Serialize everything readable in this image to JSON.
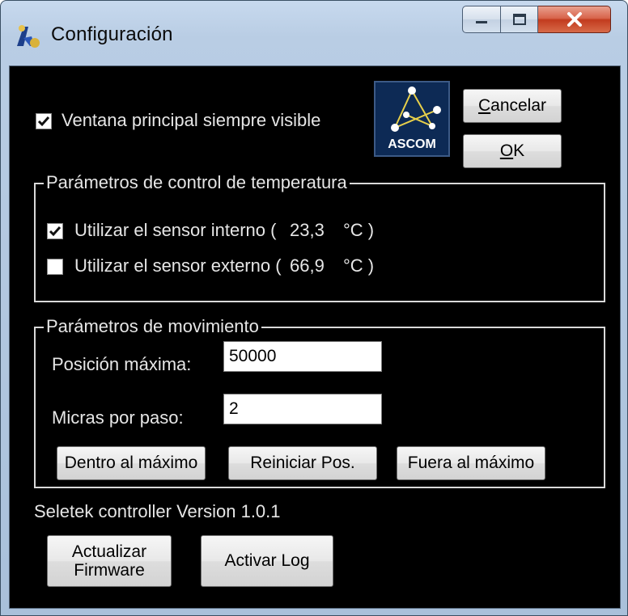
{
  "window": {
    "title": "Configuración",
    "caption_buttons": {
      "minimize": "minimize-icon",
      "maximize": "maximize-icon",
      "close": "close-icon"
    }
  },
  "top": {
    "always_visible": {
      "label": "Ventana principal siempre visible",
      "checked": true
    },
    "logo_text": "ASCOM",
    "cancel_prefix": "C",
    "cancel_rest": "ancelar",
    "ok_prefix": "O",
    "ok_rest": "K"
  },
  "temperature": {
    "legend": "Parámetros de control de temperatura",
    "internal": {
      "label": "Utilizar el sensor interno (",
      "value": "23,3",
      "unit": "°C )",
      "checked": true
    },
    "external": {
      "label": "Utilizar el sensor externo (",
      "value": "66,9",
      "unit": "°C )",
      "checked": false
    }
  },
  "movement": {
    "legend": "Parámetros de movimiento",
    "max_position": {
      "label": "Posición máxima:",
      "value": "50000"
    },
    "microns_per_step": {
      "label": "Micras por paso:",
      "value": "2"
    },
    "buttons": {
      "inside_max": "Dentro al máximo",
      "reset_pos": "Reiniciar Pos.",
      "outside_max": "Fuera al máximo"
    }
  },
  "version": "Seletek controller Version 1.0.1",
  "bottom": {
    "update_firmware_line1": "Actualizar",
    "update_firmware_line2": "Firmware",
    "activate_log": "Activar Log"
  },
  "colors": {
    "client_bg": "#000000",
    "text": "#e6e6e6",
    "close_button": "#c23b1f"
  }
}
